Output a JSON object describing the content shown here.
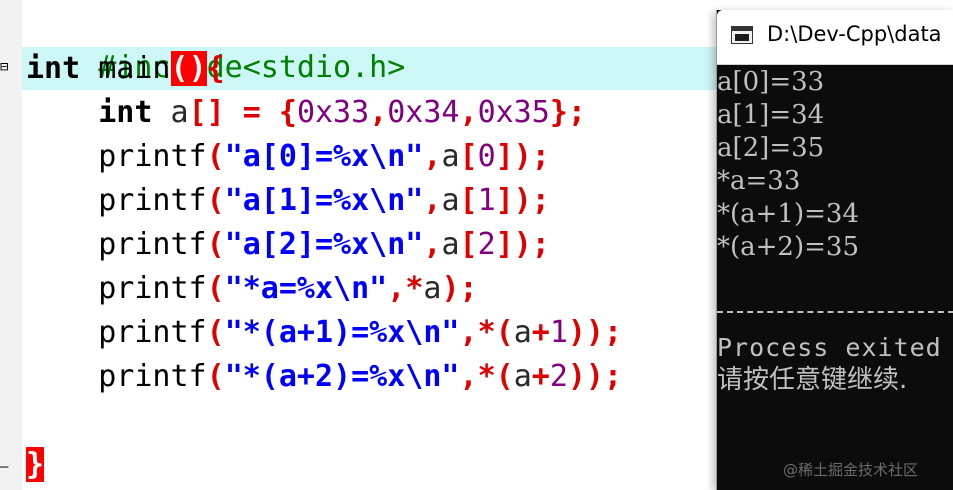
{
  "editor": {
    "include_line": "#include<stdio.h>",
    "keyword_int": "int",
    "func_name": "main",
    "open_paren": "(",
    "close_paren": ")",
    "open_brace": "{",
    "close_brace": "}",
    "decl": {
      "type": "int",
      "var": "a",
      "brackets": "[]",
      "eq": " = ",
      "lbrace": "{",
      "n1": "0x33",
      "comma1": ",",
      "n2": "0x34",
      "comma2": ",",
      "n3": "0x35",
      "rbrace_semi": "};"
    },
    "printf_lines": [
      {
        "fn": "printf",
        "lp": "(",
        "str": "\"a[0]=%x\\n\"",
        "comma": ",",
        "var": "a",
        "lb": "[",
        "idx": "0",
        "rb": "]",
        "tail": ");"
      },
      {
        "fn": "printf",
        "lp": "(",
        "str": "\"a[1]=%x\\n\"",
        "comma": ",",
        "var": "a",
        "lb": "[",
        "idx": "1",
        "rb": "]",
        "tail": ");"
      },
      {
        "fn": "printf",
        "lp": "(",
        "str": "\"a[2]=%x\\n\"",
        "comma": ",",
        "var": "a",
        "lb": "[",
        "idx": "2",
        "rb": "]",
        "tail": ");"
      }
    ],
    "deref_line": {
      "fn": "printf",
      "lp": "(",
      "str": "\"*a=%x\\n\"",
      "comma": ",",
      "star": "*",
      "var": "a",
      "tail": ");"
    },
    "deref_offset_lines": [
      {
        "fn": "printf",
        "lp": "(",
        "str": "\"*(a+1)=%x\\n\"",
        "comma": ",",
        "star_lp": "*(",
        "var": "a",
        "plus": "+",
        "num": "1",
        "tail": "));"
      },
      {
        "fn": "printf",
        "lp": "(",
        "str": "\"*(a+2)=%x\\n\"",
        "comma": ",",
        "star_lp": "*(",
        "var": "a",
        "plus": "+",
        "num": "2",
        "tail": "));"
      }
    ],
    "fold_open": "⊟",
    "fold_end": "–"
  },
  "console": {
    "title": "D:\\Dev-Cpp\\data",
    "output": [
      "a[0]=33",
      "a[1]=34",
      "a[2]=35",
      "*a=33",
      "*(a+1)=34",
      "*(a+2)=35"
    ],
    "exit_text": "Process exited",
    "prompt_text": "请按任意键继续.",
    "watermark": "@稀土掘金技术社区"
  },
  "colors": {
    "highlight_line": "#cdf6f6",
    "preprocessor": "#008000",
    "symbol": "#e00000",
    "string": "#0000ff",
    "number": "#800080",
    "console_bg": "#0c0c0c",
    "console_text": "#c0c0c0"
  }
}
